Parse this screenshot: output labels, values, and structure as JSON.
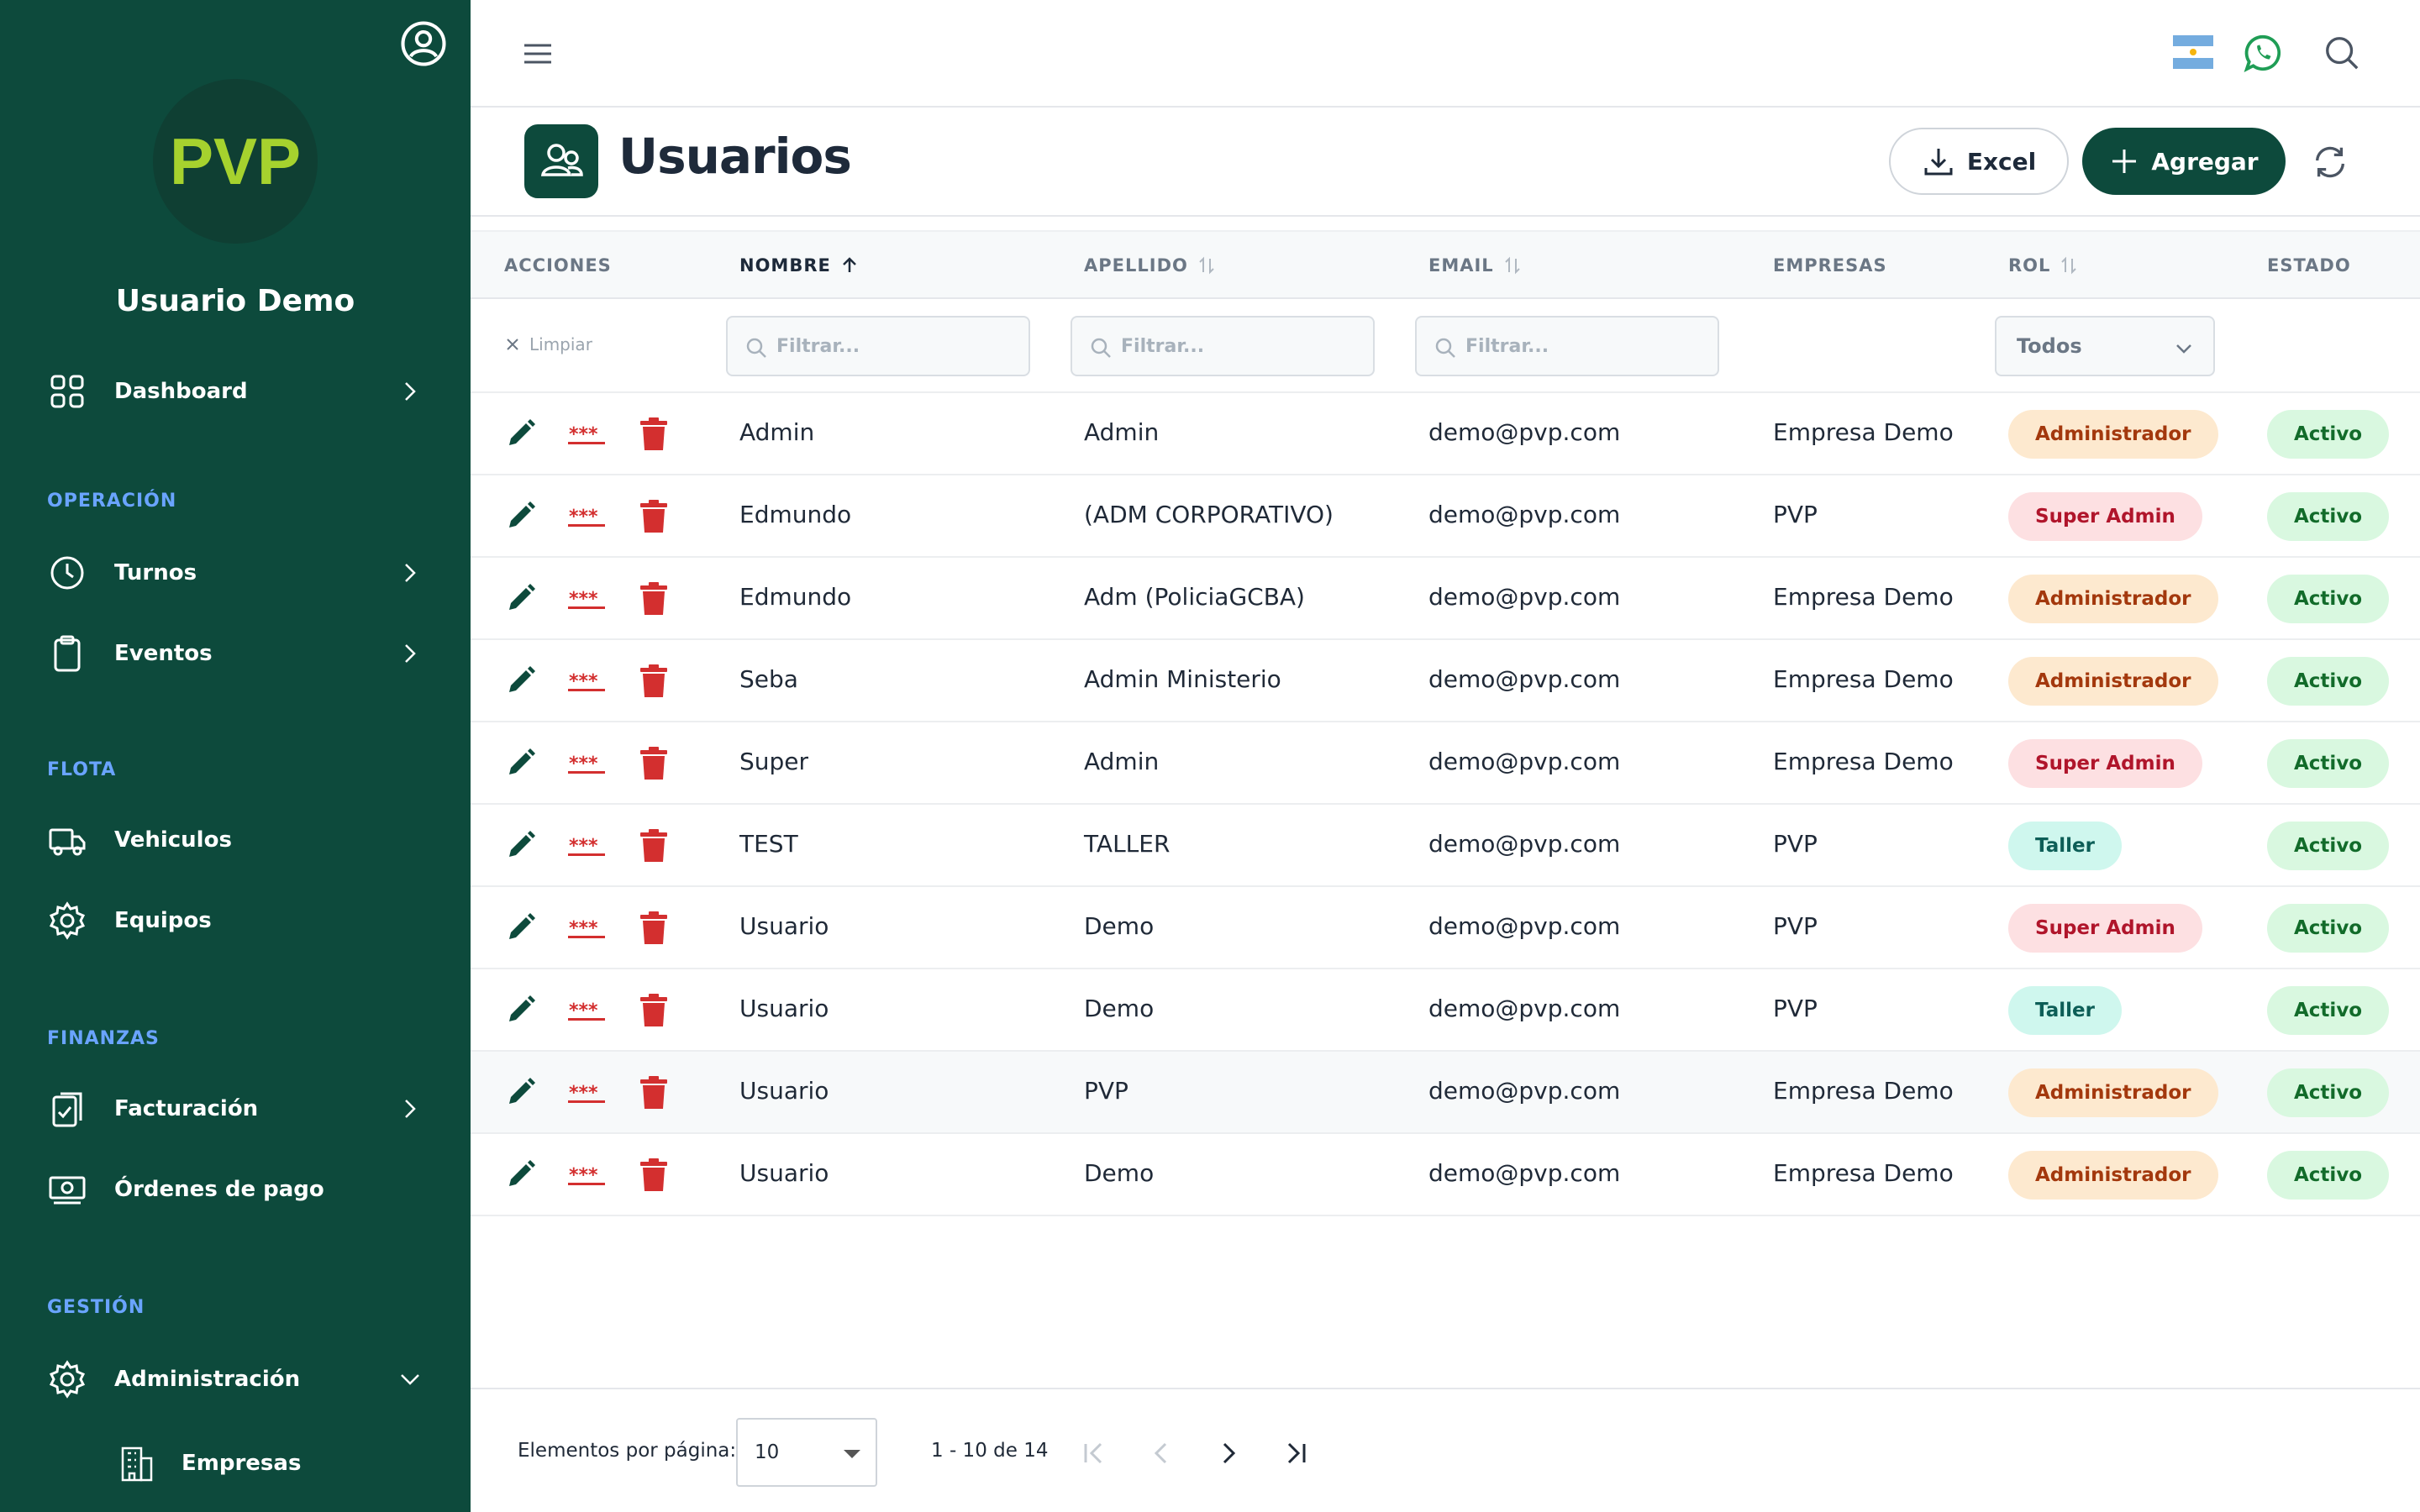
{
  "sidebar": {
    "username": "Usuario Demo",
    "logo_text": "PVP",
    "dashboard": "Dashboard",
    "sections": {
      "operacion": "OPERACIÓN",
      "flota": "FLOTA",
      "finanzas": "FINANZAS",
      "gestion": "GESTIÓN"
    },
    "items": {
      "turnos": "Turnos",
      "eventos": "Eventos",
      "vehiculos": "Vehiculos",
      "equipos": "Equipos",
      "facturacion": "Facturación",
      "ordenes": "Órdenes de pago",
      "administracion": "Administración",
      "empresas": "Empresas"
    }
  },
  "header": {
    "title": "Usuarios",
    "excel_label": "Excel",
    "add_label": "Agregar"
  },
  "table": {
    "columns": {
      "acciones": "ACCIONES",
      "nombre": "NOMBRE",
      "apellido": "APELLIDO",
      "email": "EMAIL",
      "empresas": "EMPRESAS",
      "rol": "ROL",
      "estado": "ESTADO"
    },
    "filters": {
      "clear": "Limpiar",
      "placeholder": "Filtrar...",
      "rol_selected": "Todos"
    },
    "rows": [
      {
        "nombre": "Admin",
        "apellido": "Admin",
        "email": "demo@pvp.com",
        "empresa": "Empresa Demo",
        "rol": "Administrador",
        "rol_type": "admin",
        "estado": "Activo"
      },
      {
        "nombre": "Edmundo",
        "apellido": "(ADM CORPORATIVO)",
        "email": "demo@pvp.com",
        "empresa": "PVP",
        "rol": "Super Admin",
        "rol_type": "super",
        "estado": "Activo"
      },
      {
        "nombre": "Edmundo",
        "apellido": "Adm (PoliciaGCBA)",
        "email": "demo@pvp.com",
        "empresa": "Empresa Demo",
        "rol": "Administrador",
        "rol_type": "admin",
        "estado": "Activo"
      },
      {
        "nombre": "Seba",
        "apellido": "Admin Ministerio",
        "email": "demo@pvp.com",
        "empresa": "Empresa Demo",
        "rol": "Administrador",
        "rol_type": "admin",
        "estado": "Activo"
      },
      {
        "nombre": "Super",
        "apellido": "Admin",
        "email": "demo@pvp.com",
        "empresa": "Empresa Demo",
        "rol": "Super Admin",
        "rol_type": "super",
        "estado": "Activo"
      },
      {
        "nombre": "TEST",
        "apellido": "TALLER",
        "email": "demo@pvp.com",
        "empresa": "PVP",
        "rol": "Taller",
        "rol_type": "taller",
        "estado": "Activo"
      },
      {
        "nombre": "Usuario",
        "apellido": "Demo",
        "email": "demo@pvp.com",
        "empresa": "PVP",
        "rol": "Super Admin",
        "rol_type": "super",
        "estado": "Activo"
      },
      {
        "nombre": "Usuario",
        "apellido": "Demo",
        "email": "demo@pvp.com",
        "empresa": "PVP",
        "rol": "Taller",
        "rol_type": "taller",
        "estado": "Activo"
      },
      {
        "nombre": "Usuario",
        "apellido": "PVP",
        "email": "demo@pvp.com",
        "empresa": "Empresa Demo",
        "rol": "Administrador",
        "rol_type": "admin",
        "estado": "Activo"
      },
      {
        "nombre": "Usuario",
        "apellido": "Demo",
        "email": "demo@pvp.com",
        "empresa": "Empresa Demo",
        "rol": "Administrador",
        "rol_type": "admin",
        "estado": "Activo"
      }
    ]
  },
  "footer": {
    "per_page_label": "Elementos por página:",
    "per_page_value": "10",
    "range": "1 - 10 de 14"
  },
  "colors": {
    "brand": "#0d4a3c",
    "logo": "#a6d22e",
    "section": "#6aa4ff",
    "danger": "#d32f2f"
  }
}
